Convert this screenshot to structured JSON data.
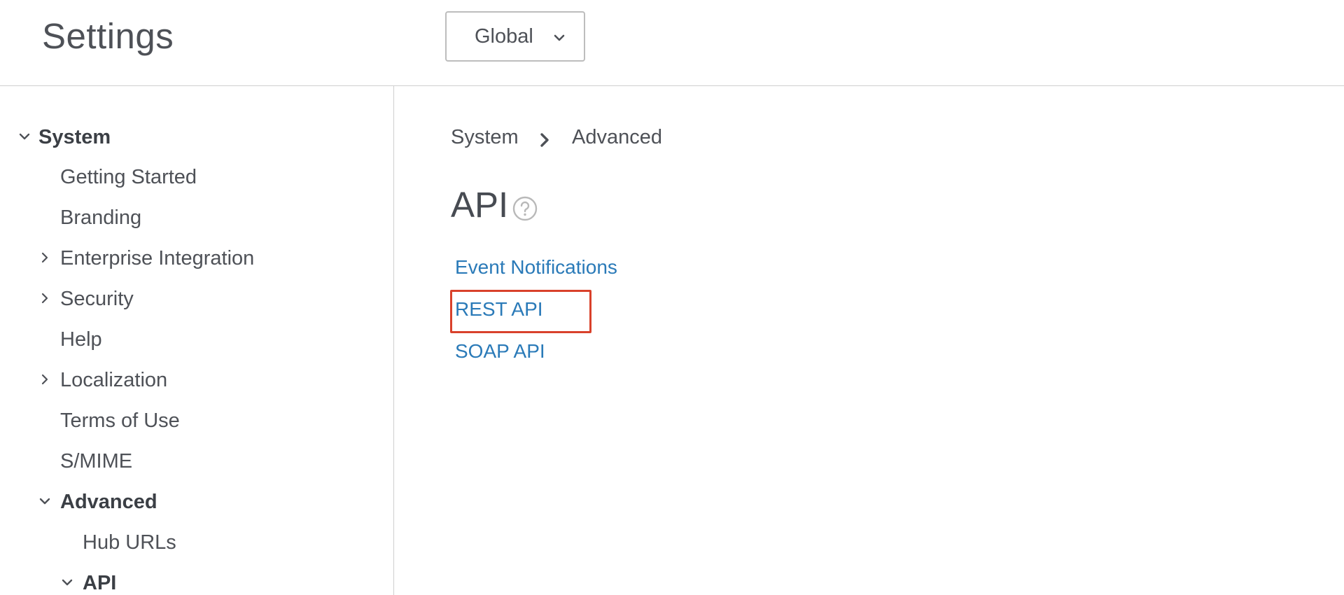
{
  "header": {
    "title": "Settings",
    "scope_select": {
      "value": "Global",
      "icon": "chevron-down-icon"
    }
  },
  "sidebar": {
    "items": [
      {
        "label": "System",
        "expanded": true,
        "icon": "chevron-down-icon"
      },
      {
        "label": "Getting Started"
      },
      {
        "label": "Branding"
      },
      {
        "label": "Enterprise Integration",
        "expanded": false,
        "icon": "chevron-right-icon"
      },
      {
        "label": "Security",
        "expanded": false,
        "icon": "chevron-right-icon"
      },
      {
        "label": "Help"
      },
      {
        "label": "Localization",
        "expanded": false,
        "icon": "chevron-right-icon"
      },
      {
        "label": "Terms of Use"
      },
      {
        "label": "S/MIME"
      },
      {
        "label": "Advanced",
        "expanded": true,
        "icon": "chevron-down-icon"
      },
      {
        "label": "Hub URLs"
      },
      {
        "label": "API",
        "expanded": true,
        "icon": "chevron-down-icon"
      }
    ]
  },
  "main": {
    "breadcrumb": {
      "items": [
        "System",
        "Advanced"
      ],
      "separator_icon": "chevron-right-icon"
    },
    "title": "API",
    "help_icon": "help-circle-icon",
    "links": [
      {
        "label": "Event Notifications"
      },
      {
        "label": "REST API",
        "highlighted": true
      },
      {
        "label": "SOAP API"
      }
    ]
  },
  "colors": {
    "link": "#2a7ab8",
    "text": "#4e5157",
    "highlight_border": "#d9412b",
    "divider": "#cfcfcf"
  }
}
